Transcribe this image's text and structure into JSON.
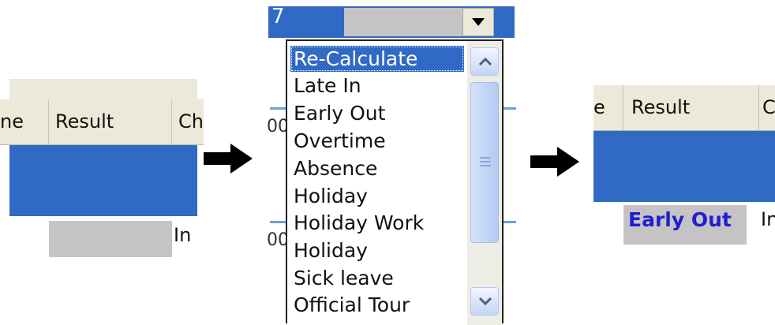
{
  "left_grid": {
    "columns": [
      "ne",
      "Result",
      "Ch"
    ],
    "row_cell_text": "In"
  },
  "dropdown": {
    "current_value": "7",
    "options": [
      "Re-Calculate",
      "Late In",
      "Early Out",
      "Overtime",
      "Absence",
      "Holiday",
      "Holiday Work",
      "Holiday",
      "Sick leave",
      "Official Tour"
    ],
    "selected_index": 0,
    "background_digits": [
      "00",
      "00"
    ]
  },
  "right_grid": {
    "columns": [
      "e",
      "Result",
      "C"
    ],
    "result_value": "Early Out",
    "row_cell_text": "In"
  },
  "colors": {
    "selection_blue": "#316ac5",
    "header_beige": "#ece9d8",
    "cell_gray": "#c6c3c6",
    "result_text_blue": "#1f1fcf"
  },
  "icons": [
    "arrow-right-icon",
    "dropdown-arrow-icon",
    "scroll-up-icon",
    "scroll-down-icon"
  ]
}
